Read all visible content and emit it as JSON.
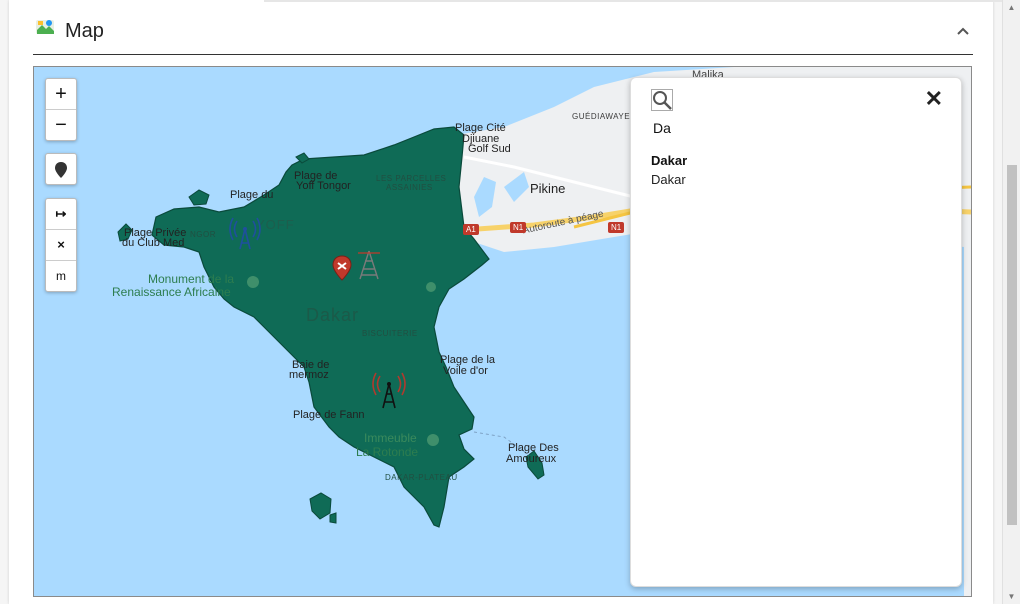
{
  "header": {
    "title": "Map",
    "app_icon": "map-app-icon",
    "collapse_icon": "chevron-up-icon"
  },
  "map_controls": {
    "zoom_in": "+",
    "zoom_out": "−",
    "marker_icon": "location-pin-icon",
    "measure_icon": "↦",
    "clear_icon": "×",
    "unit": "m"
  },
  "map_labels": {
    "malika": "Malika",
    "guediawaye": "GUÉDIAWAYE",
    "plage_cite": "Plage Cité",
    "djiuane": "Djiuane",
    "golf_sud": "Golf Sud",
    "pikine": "Pikine",
    "autoroute": "Autoroute à péage",
    "a1": "A1",
    "n1_a": "N1",
    "n1_b": "N1",
    "les_parcelles": "LES PARCELLES",
    "assainies": "ASSAINIES",
    "plage_de_yoff": "Plage de",
    "yoff_tongor": "Yoff Tongor",
    "plage_du": "Plage du",
    "plage_privee": "Plage Privée",
    "du_club_med": "du Club Med",
    "ngor": "NGOR",
    "yoff": "YOFF",
    "monument": "Monument de la",
    "renaissance": "Renaissance Africaine",
    "dakar": "Dakar",
    "biscuiterie": "BISCUITERIE",
    "baie_de": "Baie de",
    "mermoz": "mermoz",
    "plage_de_la": "Plage de la",
    "voile_dor": "Voile d'or",
    "plage_de_fann": "Plage de Fann",
    "immeuble": "Immeuble",
    "la_rotonde": "La Rotonde",
    "dakar_plateau": "DAKAR-PLATEAU",
    "plage_des": "Plage Des",
    "amoureux": "Amoureux"
  },
  "search_panel": {
    "search_icon": "search-icon",
    "query": "Da",
    "close_icon": "close-icon",
    "results": [
      {
        "name": "Dakar",
        "subtitle": "Dakar"
      }
    ]
  },
  "markers": [
    "radio-tower-blue-icon",
    "radio-tower-red-icon",
    "radio-tower-black-icon",
    "map-pin-red-icon"
  ],
  "colors": {
    "water": "#aadaff",
    "region_fill": "#0f6b56",
    "land": "#eef0f2",
    "road_yellow": "#f7d26a"
  }
}
